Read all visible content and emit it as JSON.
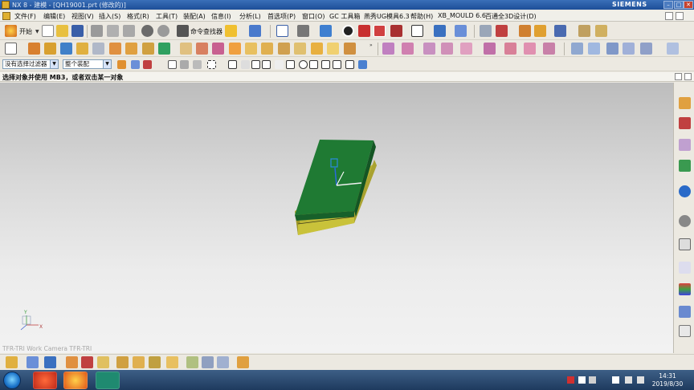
{
  "window": {
    "title": "NX 8 - 建模 - [QH19001.prt  (修改的)]",
    "brand": "SIEMENS",
    "min_glyph": "–",
    "max_glyph": "□",
    "close_glyph": "✕"
  },
  "menu": {
    "items": [
      {
        "label": "文件(F)"
      },
      {
        "label": "编辑(E)"
      },
      {
        "label": "视图(V)"
      },
      {
        "label": "插入(S)"
      },
      {
        "label": "格式(R)"
      },
      {
        "label": "工具(T)"
      },
      {
        "label": "装配(A)"
      },
      {
        "label": "信息(I)"
      },
      {
        "label": "分析(L)"
      },
      {
        "label": "首选项(P)"
      },
      {
        "label": "窗口(O)"
      },
      {
        "label": "GC 工具箱"
      },
      {
        "label": "燕秀UG模具6.3"
      },
      {
        "label": "帮助(H)"
      },
      {
        "label": "XB_MOULD 6.6"
      },
      {
        "label": "百通全3D设计(D)"
      }
    ]
  },
  "toolbar": {
    "start_label": "开始",
    "command_finder_label": "命令查找器"
  },
  "selection_bar": {
    "filter_value": "没有选择过滤器",
    "scope_value": "整个装配"
  },
  "cue_line": {
    "text": "选择对象并使用 MB3，或者双击某一对象"
  },
  "viewport": {
    "view_label": "TFR-TRI  Work  Camera  TFR-TRI",
    "triad_x": "X",
    "triad_y": "Y"
  },
  "taskbar": {
    "time": "14:31",
    "date": "2019/8/30"
  },
  "colors": {
    "title_bar": "#2a5ea8",
    "model_top": "#1f7a33",
    "model_side": "#c9c23a",
    "viewport_top": "#bdbdbd",
    "viewport_bottom": "#f2f2f2"
  }
}
